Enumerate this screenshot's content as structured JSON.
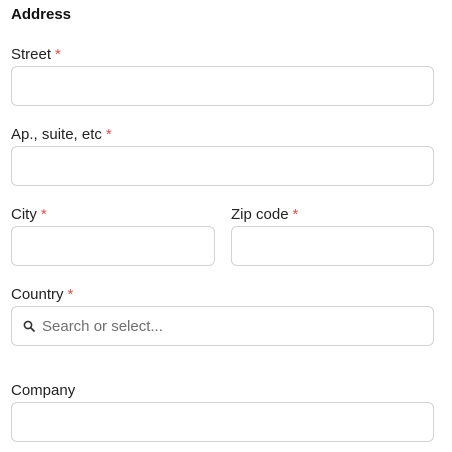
{
  "section": {
    "title": "Address"
  },
  "required_marker": "*",
  "fields": {
    "street": {
      "label": "Street",
      "value": ""
    },
    "apartment": {
      "label": "Ap., suite, etc",
      "value": ""
    },
    "city": {
      "label": "City",
      "value": ""
    },
    "zip": {
      "label": "Zip code",
      "value": ""
    },
    "country": {
      "label": "Country",
      "value": "",
      "placeholder": "Search or select..."
    },
    "company": {
      "label": "Company",
      "value": ""
    }
  },
  "colors": {
    "required": "#d9534f",
    "border": "#d3d3d3"
  },
  "icons": {
    "country_search": "search-icon"
  }
}
